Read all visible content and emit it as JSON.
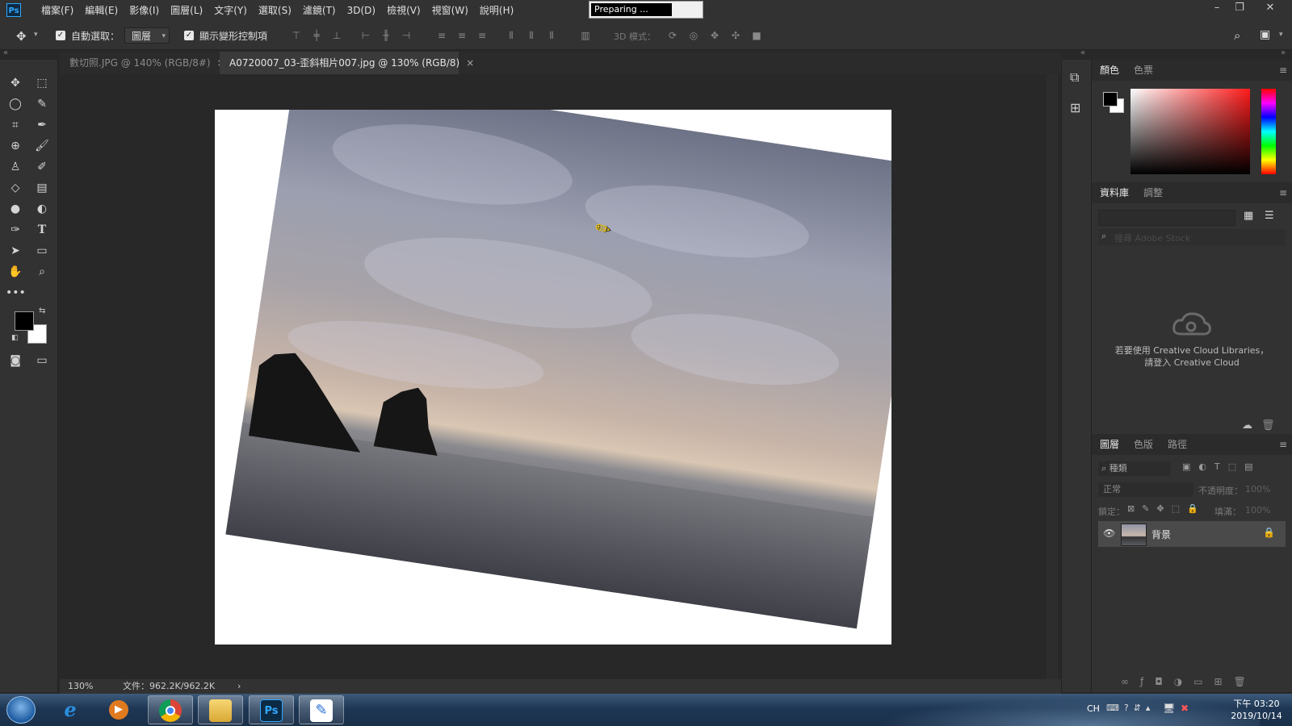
{
  "app": {
    "logo": "Ps",
    "preparing_text": "Preparing ..."
  },
  "menu": [
    "檔案(F)",
    "編輯(E)",
    "影像(I)",
    "圖層(L)",
    "文字(Y)",
    "選取(S)",
    "濾鏡(T)",
    "3D(D)",
    "檢視(V)",
    "視窗(W)",
    "說明(H)"
  ],
  "window_controls": {
    "minimize": "–",
    "restore": "❐",
    "close": "✕"
  },
  "options": {
    "auto_select_label": "自動選取：",
    "auto_select_value": "圖層",
    "transform_controls_label": "顯示變形控制項",
    "mode_3d_label": "3D 模式："
  },
  "tabs": [
    {
      "label": "數切照.JPG @ 140% (RGB/8#)",
      "close": "×",
      "active": false
    },
    {
      "label": "A0720007_03-歪斜相片007.jpg @ 130% (RGB/8)",
      "close": "×",
      "active": true
    }
  ],
  "status": {
    "zoom": "130%",
    "doc_info": "文件：962.2K/962.2K",
    "arrow": "›"
  },
  "panels": {
    "color_tabs": [
      "顏色",
      "色票"
    ],
    "library_tabs": [
      "資料庫",
      "調整"
    ],
    "library_search_placeholder": "搜尋 Adobe Stock",
    "cc_message_line1": "若要使用 Creative Cloud Libraries，",
    "cc_message_line2": "請登入 Creative Cloud",
    "layer_tabs": [
      "圖層",
      "色版",
      "路徑"
    ],
    "layer_filter": "種類",
    "blend_mode": "正常",
    "opacity_label": "不透明度：",
    "opacity_value": "100%",
    "lock_label": "鎖定：",
    "fill_label": "填滿：",
    "fill_value": "100%",
    "layer_name": "背景"
  },
  "tools": [
    "move",
    "marquee",
    "lasso",
    "quick-select",
    "crop",
    "eyedropper",
    "healing",
    "brush",
    "stamp",
    "history-brush",
    "eraser",
    "gradient",
    "blur",
    "dodge",
    "pen",
    "type",
    "path-select",
    "rectangle",
    "hand",
    "zoom"
  ],
  "taskbar": {
    "apps": [
      "internet-explorer",
      "media-player",
      "chrome",
      "file-explorer",
      "photoshop",
      "paint"
    ],
    "ime": "CH",
    "time": "下午 03:20",
    "date": "2019/10/14"
  },
  "colors": {
    "accent": "#31a8ff",
    "panel_bg": "#323232",
    "canvas_bg": "#282828"
  }
}
